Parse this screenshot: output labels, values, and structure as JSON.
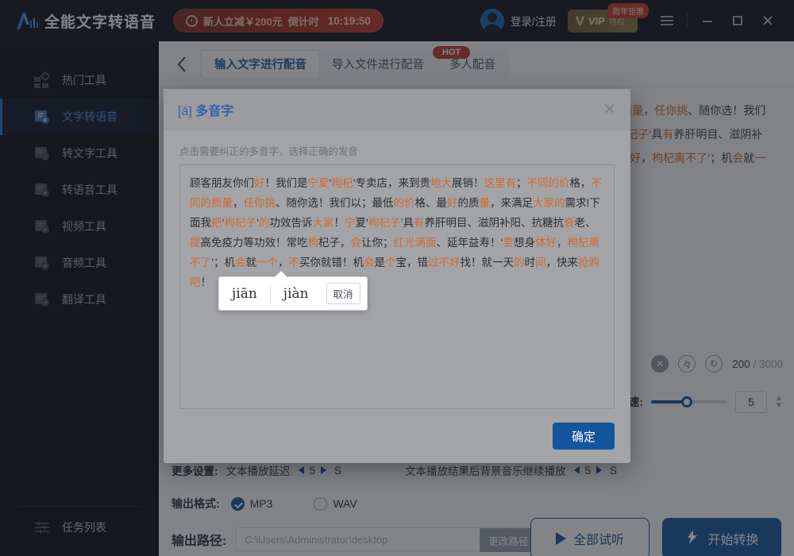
{
  "titlebar": {
    "app_name": "全能文字转语音",
    "logo_icon": "letter-a-logo",
    "promo": {
      "icon": "alarm-clock-icon",
      "text": "新人立减￥200元",
      "countdown_label": "倒计时",
      "countdown": "10:19:50"
    },
    "account_label": "登录/注册",
    "avatar_icon": "user-avatar",
    "vip": {
      "mark": "V",
      "label": "VIP",
      "sub": "特权",
      "badge": "周年钜惠"
    },
    "window": {
      "menu_icon": "hamburger-menu-icon",
      "minimize_icon": "minimize-icon",
      "maximize_icon": "maximize-icon",
      "close_icon": "close-icon"
    }
  },
  "sidebar": {
    "items": [
      {
        "label": "热门工具",
        "icon": "hot-tools-icon",
        "active": false
      },
      {
        "label": "文字转语音",
        "icon": "text-to-speech-icon",
        "active": true
      },
      {
        "label": "转文字工具",
        "icon": "to-text-tools-icon",
        "active": false
      },
      {
        "label": "转语音工具",
        "icon": "to-speech-tools-icon",
        "active": false
      },
      {
        "label": "视频工具",
        "icon": "video-tools-icon",
        "active": false
      },
      {
        "label": "音频工具",
        "icon": "audio-tools-icon",
        "active": false
      },
      {
        "label": "翻译工具",
        "icon": "translate-tools-icon",
        "active": false
      }
    ],
    "tasklist": {
      "label": "任务列表",
      "icon": "task-list-icon"
    }
  },
  "tabs": {
    "back_icon": "chevron-left-icon",
    "items": [
      {
        "label": "输入文字进行配音",
        "active": true
      },
      {
        "label": "导入文件进行配音",
        "active": false
      },
      {
        "label": "多人配音",
        "active": false
      }
    ],
    "hot_badge": "HOT"
  },
  "editor": {
    "text": "顾客朋友你们好！我们是宁夏‘枸杞’专卖店，来到贵地大展销！这里有；不同的价格，不同的质量，任你挑、随你选！我们以；最低的价格、最好的质量，来满足大家的需求!下面我把‘枸杞子‘的功效告诉大家！宁夏‘枸杞子’具有养肝明目、滋阴补阳、抗糖抗衰老、提高免疫力等功效！常吃枸杞子，会让你；红光满面、延年益寿！‘要想身体好，枸杞离不了’；机会就一个，不买你就错！机会是个宝，错过不好找！就一天的时间，快来抢购吧！",
    "char_count": "200",
    "char_total": "/ 3000",
    "clear_icon": "clear-circle-icon",
    "polyphone_icon": "polyphone-circle-icon",
    "refresh_icon": "refresh-circle-icon",
    "speed_label": "语速:",
    "speed_value": "5"
  },
  "settings": {
    "more_label": "更多设置:",
    "delay_label": "文本播放延迟",
    "delay_value": "5",
    "delay_unit": "S",
    "bgm_label": "文本播放结果后背景音乐继续播放",
    "bgm_value": "5",
    "bgm_unit": "S",
    "format_label": "输出格式:",
    "format_options": [
      {
        "label": "MP3",
        "selected": true
      },
      {
        "label": "WAV",
        "selected": false
      }
    ],
    "path_label": "输出路径:",
    "path_value": "C:\\Users\\Administrator\\desktop",
    "path_button": "更改路径"
  },
  "actions": {
    "preview_label": "全部试听",
    "preview_icon": "play-icon",
    "convert_label": "开始转换",
    "convert_icon": "convert-lightning-icon"
  },
  "modal": {
    "ipa": "[ā]",
    "title": "多音字",
    "close_icon": "close-icon",
    "subtitle": "点击需要纠正的多音字，选择正确的发音",
    "text": "顾客朋友你们好！我们是宁夏‘枸杞’专卖店，来到贵地大展销！这里有；不同的价格，不同的质量，任你挑、随你选！我们以；最低的价格、最好的质量，来满足大家的需求!下面我把‘枸杞子‘的功效告诉大家！宁夏‘枸杞子’具有养肝明目、滋阴补阳、抗糖抗衰老、提高免疫力等功效！常吃枸杞子，会让你；红光满面、延年益寿！‘要想身体好，枸杞离不了’；机会就一个，不买你就错！机会是个宝，错过不好找！就一天的时间，快来抢购吧！",
    "confirm_label": "确定",
    "pronunciation_popup": {
      "options": [
        "jiān",
        "jiàn"
      ],
      "cancel_label": "取消"
    }
  },
  "colors": {
    "accent_blue": "#14559e",
    "highlight_orange": "#d4682a",
    "promo_red": "#c0392b",
    "sidebar_bg": "#0d0f16"
  }
}
